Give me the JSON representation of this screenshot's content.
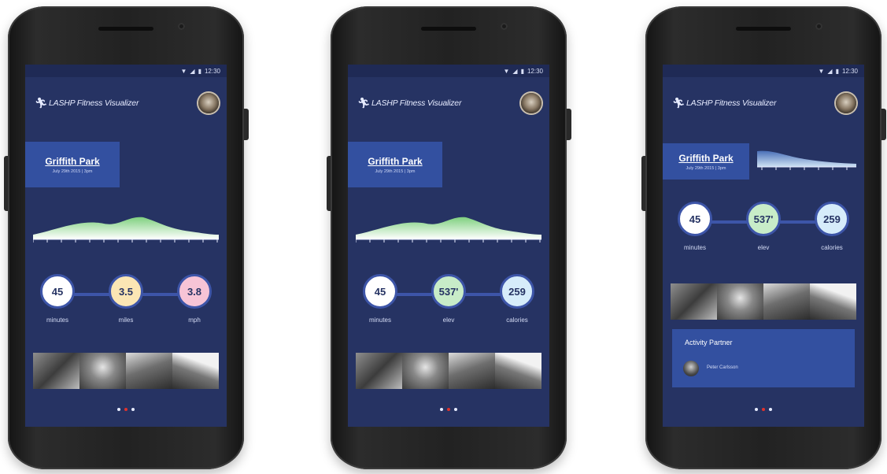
{
  "status": {
    "time": "12:30"
  },
  "app": {
    "title": "LASHP Fitness Visualizer",
    "logo_icon": "runner-icon",
    "accent": "#263363"
  },
  "location": {
    "name": "Griffith Park",
    "date": "July 29th 2015 | 3pm"
  },
  "phones": [
    {
      "stats": [
        {
          "value": "45",
          "label": "minutes",
          "color": "#ffffff"
        },
        {
          "value": "3.5",
          "label": "miles",
          "color": "#fbe6b4"
        },
        {
          "value": "3.8",
          "label": "mph",
          "color": "#f7c4d6"
        }
      ],
      "active_dot": 1
    },
    {
      "stats": [
        {
          "value": "45",
          "label": "minutes",
          "color": "#ffffff"
        },
        {
          "value": "537'",
          "label": "elev",
          "color": "#c8ecc8"
        },
        {
          "value": "259",
          "label": "calories",
          "color": "#d6ecfa"
        }
      ],
      "active_dot": 1
    },
    {
      "stats": [
        {
          "value": "45",
          "label": "minutes",
          "color": "#ffffff"
        },
        {
          "value": "537'",
          "label": "elev",
          "color": "#c8ecc8"
        },
        {
          "value": "259",
          "label": "calories",
          "color": "#d6ecfa"
        }
      ],
      "active_dot": 1,
      "partner": {
        "title": "Activity Partner",
        "name": "Peter Carlsson"
      }
    }
  ]
}
